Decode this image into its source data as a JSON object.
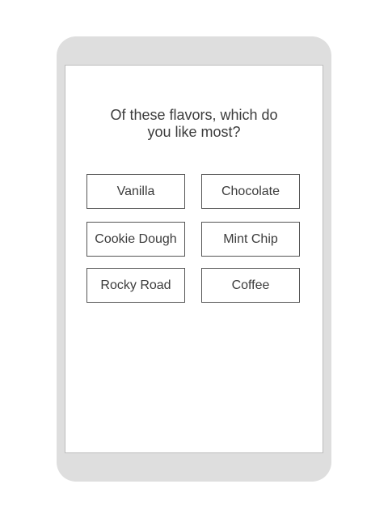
{
  "survey": {
    "question": "Of these flavors, which do you like most?",
    "options": [
      {
        "label": "Vanilla"
      },
      {
        "label": "Chocolate"
      },
      {
        "label": "Cookie Dough"
      },
      {
        "label": "Mint Chip"
      },
      {
        "label": "Rocky Road"
      },
      {
        "label": "Coffee"
      }
    ]
  },
  "colors": {
    "device_frame": "#dedede",
    "screen_background": "#ffffff",
    "text": "#3c3c3c",
    "option_border": "#555555"
  }
}
